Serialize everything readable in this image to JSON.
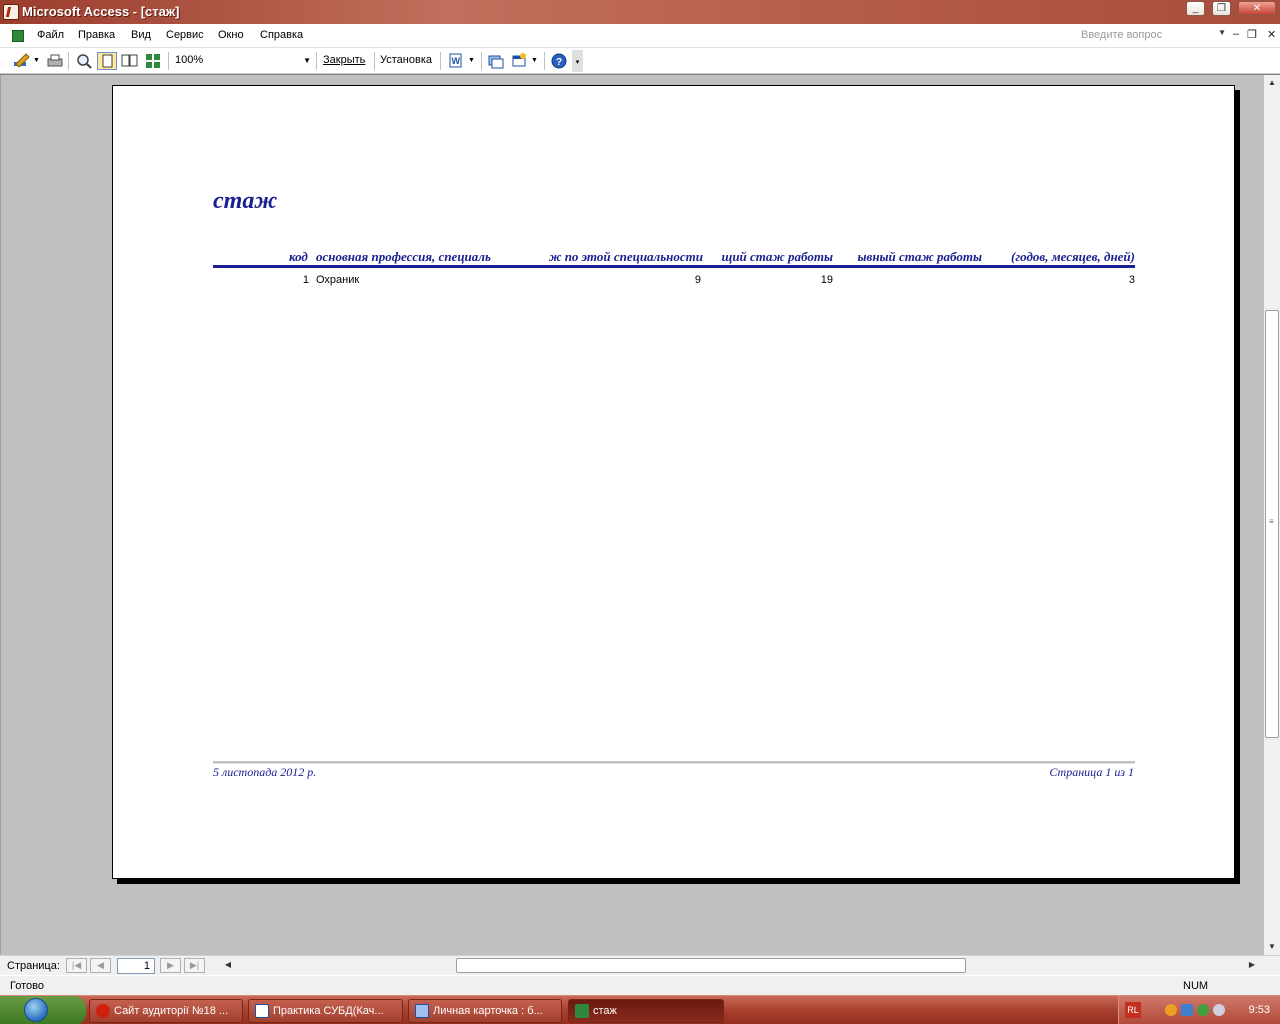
{
  "window": {
    "title": "Microsoft Access - [стаж]"
  },
  "menu": {
    "items": [
      "Файл",
      "Правка",
      "Вид",
      "Сервис",
      "Окно",
      "Справка"
    ],
    "ask_placeholder": "Введите вопрос"
  },
  "toolbar": {
    "zoom": "100%",
    "close_label": "Закрыть",
    "setup_label": "Установка"
  },
  "report": {
    "title": "стаж",
    "columns": [
      "код",
      "основная профессия, специаль",
      "ж по этой специальности",
      "щий стаж работы",
      "ывный стаж работы",
      "(годов, месяцев, дней)"
    ],
    "rows": [
      {
        "code": "1",
        "profession": "Охраник",
        "spec_years": "9",
        "total_years": "19",
        "continuous_years": "3"
      }
    ],
    "footer_date": "5 листопада 2012 р.",
    "footer_page": "Страница 1 из 1"
  },
  "navigation": {
    "label": "Страница:",
    "current_page": "1"
  },
  "status": {
    "text": "Готово",
    "num": "NUM"
  },
  "taskbar": {
    "tasks": [
      "Сайт аудиторії №18 ...",
      "Практика СУБД(Кач...",
      "Личная карточка : б...",
      "стаж"
    ],
    "tray_lang": "RL",
    "clock": "9:53"
  },
  "colors": {
    "report_accent": "#1a2090",
    "title_bar": "#b45a48",
    "taskbar": "#a8402e"
  }
}
